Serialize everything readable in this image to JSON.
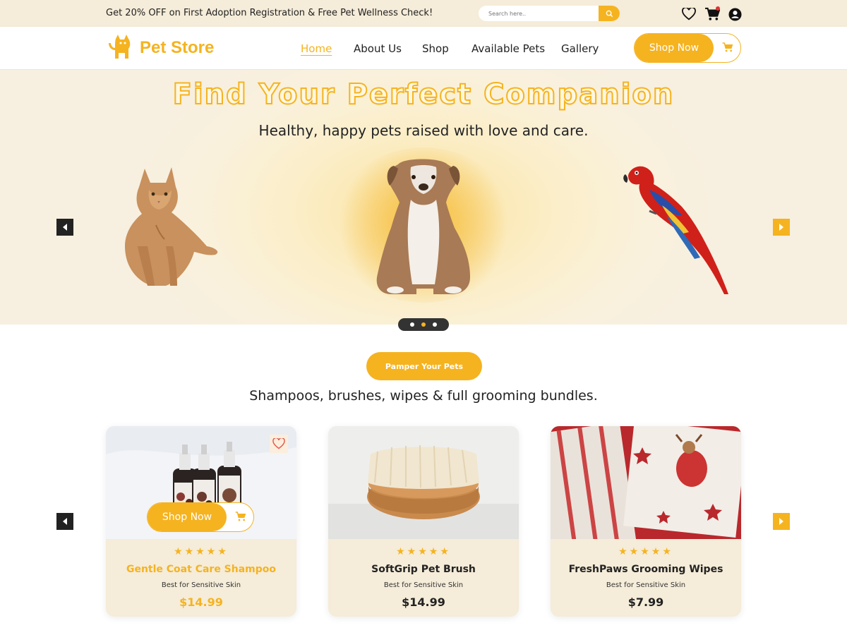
{
  "topbar": {
    "promo": "Get 20% OFF on First Adoption Registration & Free Pet Wellness Check!",
    "search_placeholder": "Search here..",
    "icons": [
      "heart-icon",
      "cart-icon",
      "user-icon"
    ]
  },
  "header": {
    "logo_text": "Pet Store",
    "nav": [
      "Home",
      "About Us",
      "Shop",
      "Available Pets",
      "Gallery"
    ],
    "active_nav": "Home",
    "cta": "Shop Now"
  },
  "hero": {
    "title": "Find Your Perfect Companion",
    "subtitle": "Healthy, happy pets raised with love and care.",
    "slides": 3,
    "active_slide": 2
  },
  "section": {
    "button": "Pamper Your Pets",
    "subtitle": "Shampoos, brushes, wipes & full grooming bundles."
  },
  "products": [
    {
      "name": "Gentle Coat Care Shampoo",
      "note": "Best for Sensitive Skin",
      "price": "$14.99",
      "rating": 5,
      "stars": "★★★★★",
      "cta": "Shop Now"
    },
    {
      "name": "SoftGrip Pet Brush",
      "note": "Best for Sensitive Skin",
      "price": "$14.99",
      "rating": 5,
      "stars": "★★★★★"
    },
    {
      "name": "FreshPaws Grooming Wipes",
      "note": "Best for Sensitive Skin",
      "price": "$7.99",
      "rating": 5,
      "stars": "★★★★★"
    }
  ],
  "colors": {
    "accent": "#f5b320",
    "cream": "#f5ecd9",
    "dark": "#222222"
  }
}
